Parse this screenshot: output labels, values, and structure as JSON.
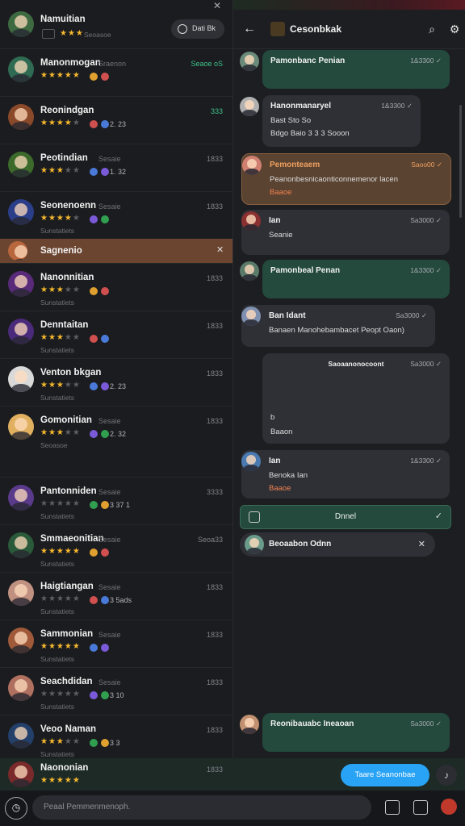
{
  "left_header": {
    "name": "Namuitian",
    "subtitle": "Seoasoe",
    "pill_label": "Dati  Bk",
    "pin_icon": "pin-icon"
  },
  "contacts": [
    {
      "name": "Manonmogan",
      "meta": "Sraenon",
      "time": "Seaoe  oS",
      "stars": 5,
      "score": "",
      "sub": ""
    },
    {
      "name": "Reonindgan",
      "meta": "",
      "time": "333",
      "stars": 4,
      "score": "2. 23",
      "sub": ""
    },
    {
      "name": "Peotindian",
      "meta": "Sesaie",
      "time": "1833",
      "stars": 3,
      "score": "1. 32",
      "sub": ""
    },
    {
      "name": "Seonenoenn",
      "meta": "Sesaie",
      "time": "1833",
      "stars": 4,
      "score": "",
      "sub": "Sunstatiets"
    },
    {
      "name": "Sagnenio",
      "meta": "",
      "time": "",
      "stars": 0,
      "score": "",
      "sub": "",
      "highlight": true
    },
    {
      "name": "Nanonnitian",
      "meta": "",
      "time": "1833",
      "stars": 3,
      "score": "",
      "sub": "Sunstatiets"
    },
    {
      "name": "Denntaitan",
      "meta": "",
      "time": "1833",
      "stars": 3,
      "score": "",
      "sub": "Sunstatiets"
    },
    {
      "name": "Venton bkgan",
      "meta": "",
      "time": "1833",
      "stars": 3,
      "score": "2. 23",
      "sub": "Sunstatiets"
    },
    {
      "name": "Gomonitian",
      "meta": "Sesaie",
      "time": "1833",
      "stars": 3,
      "score": "2. 32",
      "sub": "Seoasoe"
    },
    {
      "name": "Pantonniden",
      "meta": "Sesaie",
      "time": "3333",
      "stars": 0,
      "score": "3 37 1",
      "sub": "Sunstatiets"
    },
    {
      "name": "Smmaeonitian",
      "meta": "Sesaie",
      "time": "Seoa33",
      "stars": 5,
      "score": "",
      "sub": "Sunstatiets"
    },
    {
      "name": "Haigtiangan",
      "meta": "Sesaie",
      "time": "1833",
      "stars": 0,
      "score": "3 5ads",
      "sub": "Sunstatiets"
    },
    {
      "name": "Sammonian",
      "meta": "Sesaie",
      "time": "1833",
      "stars": 5,
      "score": "",
      "sub": "Sunstatiets"
    },
    {
      "name": "Seachdidan",
      "meta": "Sesaie",
      "time": "1833",
      "stars": 0,
      "score": "3 10",
      "sub": "Sunstatiets"
    },
    {
      "name": "Veoo Naman",
      "meta": "",
      "time": "1833",
      "stars": 3,
      "score": "3 3",
      "sub": "Sunstatiets"
    }
  ],
  "current_contact": {
    "name": "Naononian",
    "time": "1833",
    "stars": 5
  },
  "chat_header": {
    "title": "Cesonbkak"
  },
  "messages": [
    {
      "name": "Pamonbanc Penian",
      "time": "1&3300",
      "text": "",
      "style": "green"
    },
    {
      "name": "Hanonmanaryel",
      "time": "1&3300",
      "text": "Bast  Sto So",
      "text2": "Bdgo  Baio  3 3 3  Sooon",
      "style": "grey"
    },
    {
      "name": "Pemonteaem",
      "time": "Saoo00",
      "text": "Peanonbesnicaonticonnemenor lacen",
      "text2": "Baaoe",
      "style": "brown"
    },
    {
      "name": "Ian",
      "time": "Sa3000",
      "text": "Seanie",
      "style": "grey"
    },
    {
      "name": "Pamonbeal Penan",
      "time": "1&3300",
      "text": "",
      "style": "green"
    },
    {
      "name": "Ban Idant",
      "time": "Sa3000",
      "text": "Banaen Manohebambacet Peopt Oaon)",
      "style": "grey"
    },
    {
      "name": "Saoaanonocoont",
      "time": "Sa3000",
      "text": "b",
      "text2": "Baaon",
      "style": "grey"
    },
    {
      "name": "Ian",
      "time": "1&3300",
      "text": "Benoka  Ian",
      "text2": "Baaoe",
      "style": "grey"
    },
    {
      "name": "Dnnel",
      "time": "",
      "text": "",
      "style": "green-bar"
    },
    {
      "name": "Beoaabon Odnn",
      "time": "",
      "text": "",
      "style": "grey-pill"
    },
    {
      "name": "Reonibauabc Ineaoan",
      "time": "Sa3000",
      "text": "",
      "style": "green"
    }
  ],
  "action_button": {
    "label": "Taare Seanonbae"
  },
  "composer": {
    "placeholder": "Peaal Pemmenmenoph."
  },
  "colors": {
    "accent": "#29a3f5",
    "green_bubble": "#234a3c",
    "brown_highlight": "#6b4530"
  }
}
